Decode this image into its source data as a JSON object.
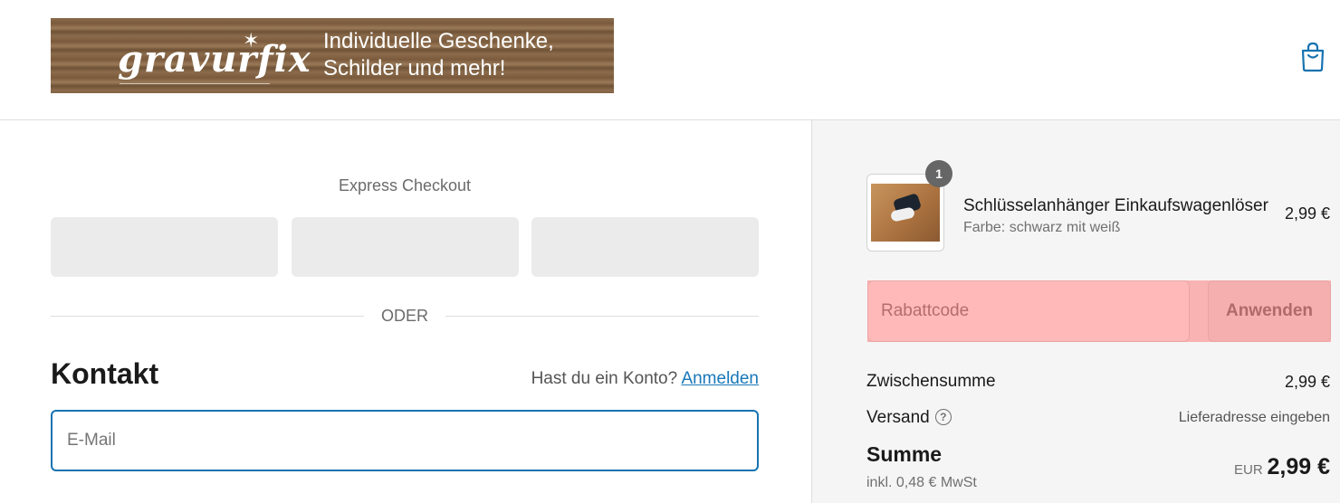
{
  "header": {
    "logo_text": "gravurfix",
    "tagline_line1": "Individuelle Geschenke,",
    "tagline_line2": "Schilder und mehr!",
    "cart_icon": "shopping-bag-icon"
  },
  "checkout": {
    "express_title": "Express Checkout",
    "divider_text": "ODER",
    "contact_heading": "Kontakt",
    "account_prompt": "Hast du ein Konto?",
    "login_link": "Anmelden",
    "email_placeholder": "E-Mail"
  },
  "summary": {
    "item": {
      "quantity": "1",
      "name": "Schlüsselanhänger Einkaufswagenlöser",
      "variant": "Farbe: schwarz mit weiß",
      "price": "2,99 €"
    },
    "discount_placeholder": "Rabattcode",
    "apply_label": "Anwenden",
    "subtotal_label": "Zwischensumme",
    "subtotal_value": "2,99 €",
    "shipping_label": "Versand",
    "shipping_value": "Lieferadresse eingeben",
    "total_label": "Summe",
    "tax_note": "inkl. 0,48 € MwSt",
    "currency": "EUR",
    "total_value": "2,99 €"
  },
  "colors": {
    "accent": "#1773b0",
    "summary_bg": "#f5f5f5",
    "highlight": "#ff6464"
  }
}
